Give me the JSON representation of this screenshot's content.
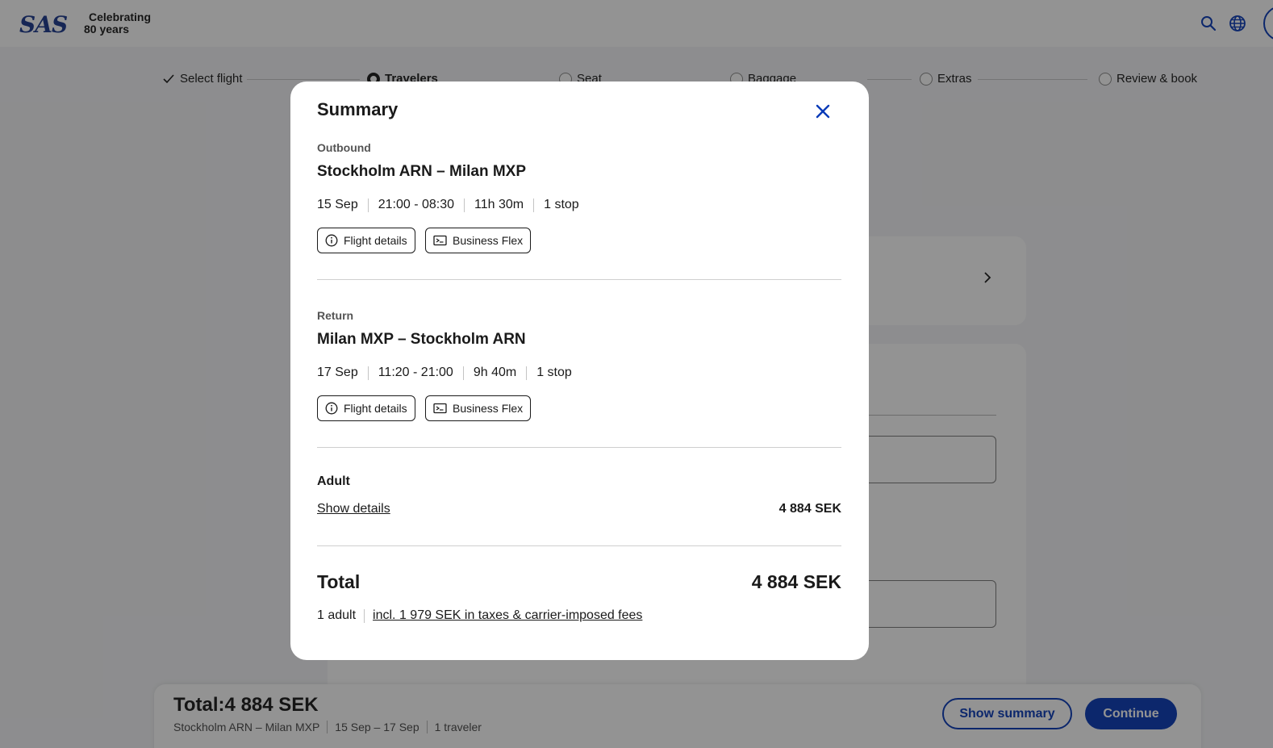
{
  "brand": {
    "logo_text": "SAS",
    "tagline_line1": "Celebrating",
    "tagline_line2": "80 years",
    "accent_color": "#0a3bb8"
  },
  "header_icons": [
    "search-icon",
    "globe-icon",
    "account-icon"
  ],
  "stepper": {
    "steps": [
      {
        "label": "Select flight",
        "state": "done"
      },
      {
        "label": "Travelers",
        "state": "current"
      },
      {
        "label": "Seat",
        "state": "upcoming"
      },
      {
        "label": "Baggage",
        "state": "upcoming"
      },
      {
        "label": "Extras",
        "state": "upcoming"
      },
      {
        "label": "Review & book",
        "state": "upcoming"
      }
    ]
  },
  "footer": {
    "total_label": "Total:",
    "total_value": "4 884 SEK",
    "route": "Stockholm ARN – Milan MXP",
    "dates": "15 Sep – 17 Sep",
    "travelers": "1 traveler",
    "show_summary_label": "Show summary",
    "continue_label": "Continue"
  },
  "summary": {
    "title": "Summary",
    "outbound": {
      "label": "Outbound",
      "route": "Stockholm ARN – Milan MXP",
      "date": "15 Sep",
      "times": "21:00 - 08:30",
      "duration": "11h 30m",
      "stops": "1 stop",
      "details_label": "Flight details",
      "fare_label": "Business Flex"
    },
    "return": {
      "label": "Return",
      "route": "Milan MXP – Stockholm ARN",
      "date": "17 Sep",
      "times": "11:20 - 21:00",
      "duration": "9h 40m",
      "stops": "1 stop",
      "details_label": "Flight details",
      "fare_label": "Business Flex"
    },
    "passenger": {
      "label": "Adult",
      "show_details_label": "Show details",
      "price": "4 884 SEK"
    },
    "total": {
      "label": "Total",
      "price": "4 884 SEK",
      "passengers": "1 adult",
      "taxes_note": "incl. 1 979 SEK in taxes & carrier-imposed fees"
    }
  }
}
